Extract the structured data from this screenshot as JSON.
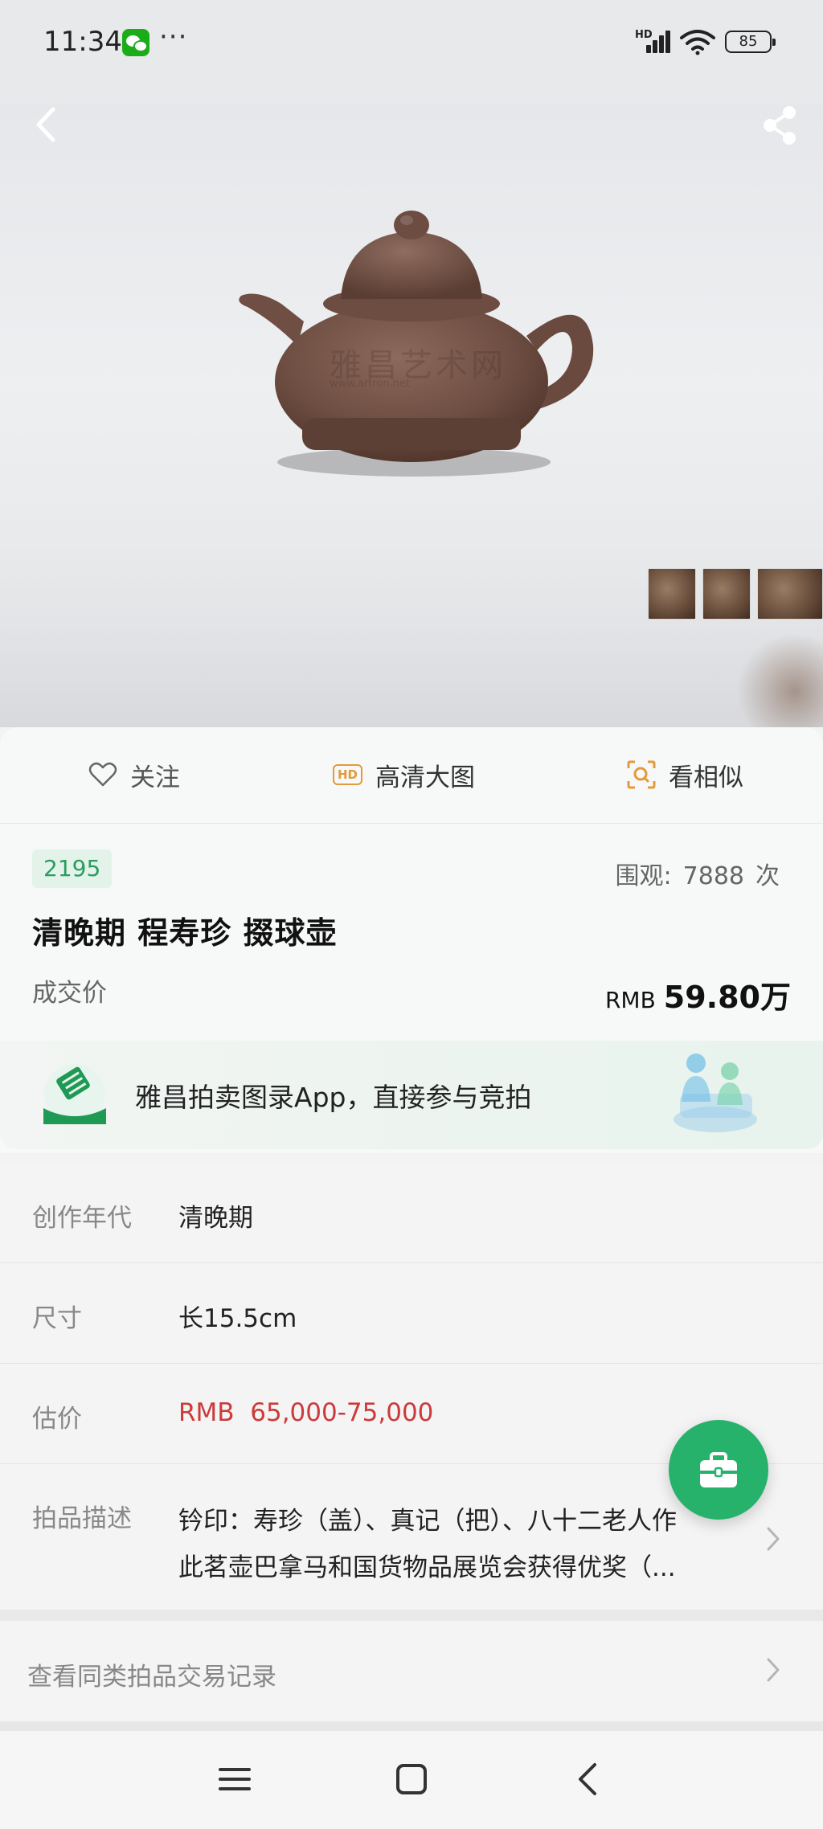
{
  "status_bar": {
    "time": "11:34",
    "more": "···",
    "battery": "85",
    "signal_label": "HD"
  },
  "watermark": "雅昌艺术网",
  "watermark_sub": "www.artron.net",
  "actions": {
    "follow": "关注",
    "hd_badge": "HD",
    "hd_image": "高清大图",
    "similar": "看相似"
  },
  "lot": {
    "number": "2195",
    "views_label": "围观:",
    "views_count": "7888",
    "views_unit": "次",
    "title": "清晚期 程寿珍 掇球壶",
    "sold_label": "成交价",
    "sold_currency": "RMB",
    "sold_price": "59.80万"
  },
  "promo": {
    "text": "雅昌拍卖图录App，直接参与竞拍"
  },
  "details": {
    "era_label": "创作年代",
    "era_value": "清晚期",
    "size_label": "尺寸",
    "size_value": "长15.5cm",
    "estimate_label": "估价",
    "estimate_value": "RMB  65,000-75,000",
    "desc_label": "拍品描述",
    "desc_line1": "钤印：寿珍（盖）、真记（把）、八十二老人作",
    "desc_line2": "此茗壶巴拿马和国货物品展览会获得优奖（..."
  },
  "history": {
    "label": "查看同类拍品交易记录"
  },
  "colors": {
    "accent_green": "#27b26b",
    "estimate_red": "#cc3a3a",
    "hd_orange": "#e39a3b"
  }
}
